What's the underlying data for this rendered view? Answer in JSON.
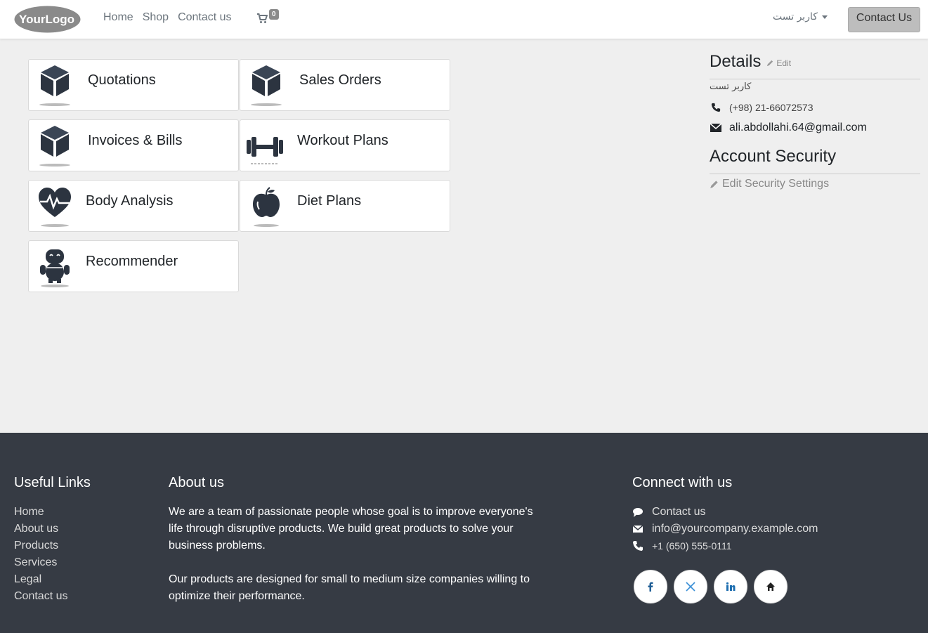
{
  "header": {
    "logo_text": "YourLogo",
    "nav": [
      "Home",
      "Shop",
      "Contact us"
    ],
    "cart_count": "0",
    "user_name": "کاربر تست",
    "contact_button": "Contact Us"
  },
  "cards": [
    {
      "label": "Quotations",
      "icon": "box-icon"
    },
    {
      "label": "Sales Orders",
      "icon": "box-icon"
    },
    {
      "label": "Invoices & Bills",
      "icon": "box-icon"
    },
    {
      "label": "Workout Plans",
      "icon": "dumbbell-icon"
    },
    {
      "label": "Body Analysis",
      "icon": "heart-pulse-icon"
    },
    {
      "label": "Diet Plans",
      "icon": "apple-icon"
    },
    {
      "label": "Recommender",
      "icon": "robot-icon"
    }
  ],
  "details": {
    "title": "Details",
    "edit_label": "Edit",
    "name": "کاربر تست",
    "phone": "(+98) 21-66072573",
    "email": "ali.abdollahi.64@gmail.com"
  },
  "security": {
    "title": "Account Security",
    "edit_label": "Edit Security Settings"
  },
  "footer": {
    "useful_links_title": "Useful Links",
    "useful_links": [
      "Home",
      "About us",
      "Products",
      "Services",
      "Legal",
      "Contact us"
    ],
    "about_title": "About us",
    "about_p1": "We are a team of passionate people whose goal is to improve everyone's life through disruptive products. We build great products to solve your business problems.",
    "about_p2": "Our products are designed for small to medium size companies willing to optimize their performance.",
    "connect_title": "Connect with us",
    "connect_contact": "Contact us",
    "connect_email": "info@yourcompany.example.com",
    "connect_phone": "+1 (650) 555-0111",
    "socials": [
      "facebook-icon",
      "x-twitter-icon",
      "linkedin-icon",
      "home-icon"
    ]
  },
  "colors": {
    "footer_bg": "#363b44",
    "page_bg": "#efefef",
    "icon_dark": "#2c3440"
  }
}
